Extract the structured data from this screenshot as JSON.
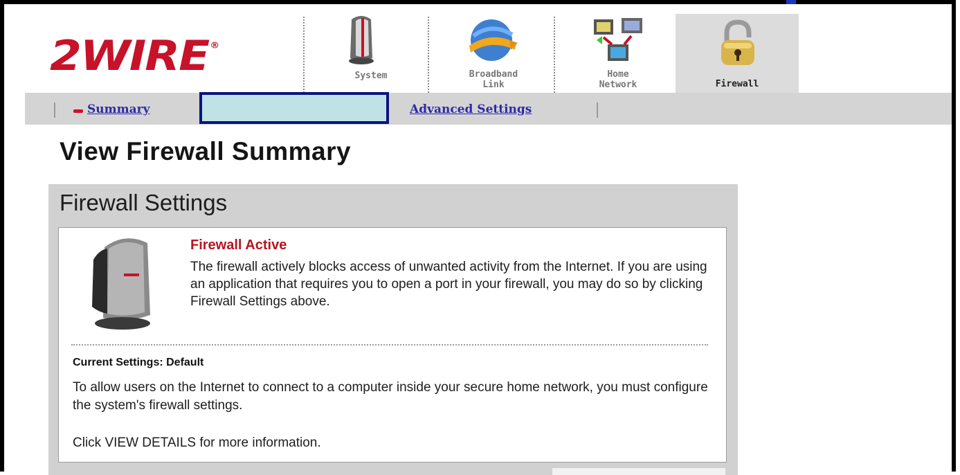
{
  "brand": {
    "logo_text": "2WIRE",
    "registered": "®"
  },
  "tabs": [
    {
      "label_line1": "System",
      "label_line2": "",
      "icon": "modem-icon",
      "active": false
    },
    {
      "label_line1": "Broadband",
      "label_line2": "Link",
      "icon": "globe-icon",
      "active": false
    },
    {
      "label_line1": "Home",
      "label_line2": "Network",
      "icon": "network-computers-icon",
      "active": false
    },
    {
      "label_line1": "Firewall",
      "label_line2": "",
      "icon": "padlock-icon",
      "active": true
    }
  ],
  "subnav": {
    "summary_label": "Summary",
    "advanced_label": "Advanced Settings"
  },
  "page": {
    "title": "View Firewall Summary"
  },
  "panel": {
    "title": "Firewall Settings",
    "status_title": "Firewall Active",
    "status_desc": "The firewall actively blocks access of unwanted activity from the Internet. If you are using an application that requires you to open a port in your firewall, you may do so by clicking Firewall Settings above.",
    "current_settings": "Current Settings: Default",
    "info": "To allow users on the Internet to connect to a computer inside your secure home network, you must configure the system's firewall settings.",
    "click_info": "Click VIEW DETAILS for more information."
  },
  "colors": {
    "brand_red": "#c7122a",
    "link_blue": "#2f2aa6",
    "highlight_fill": "#bfe2e6",
    "highlight_border": "#0b1480",
    "panel_gray": "#d1d1d1"
  }
}
